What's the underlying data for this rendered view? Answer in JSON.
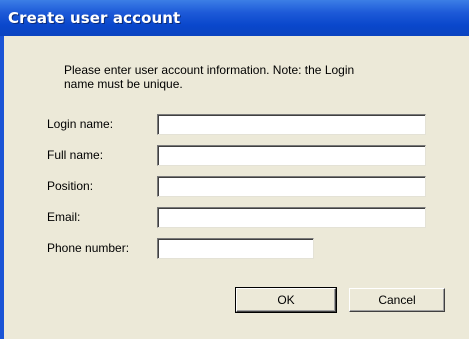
{
  "window": {
    "title": "Create user account"
  },
  "intro_text": "Please enter user account information. Note: the Login\nname  must be unique.",
  "fields": [
    {
      "label": "Login name:",
      "value": ""
    },
    {
      "label": "Full name:",
      "value": ""
    },
    {
      "label": "Position:",
      "value": ""
    },
    {
      "label": "Email:",
      "value": ""
    },
    {
      "label": "Phone number:",
      "value": ""
    }
  ],
  "buttons": {
    "ok_label": "OK",
    "cancel_label": "Cancel"
  }
}
